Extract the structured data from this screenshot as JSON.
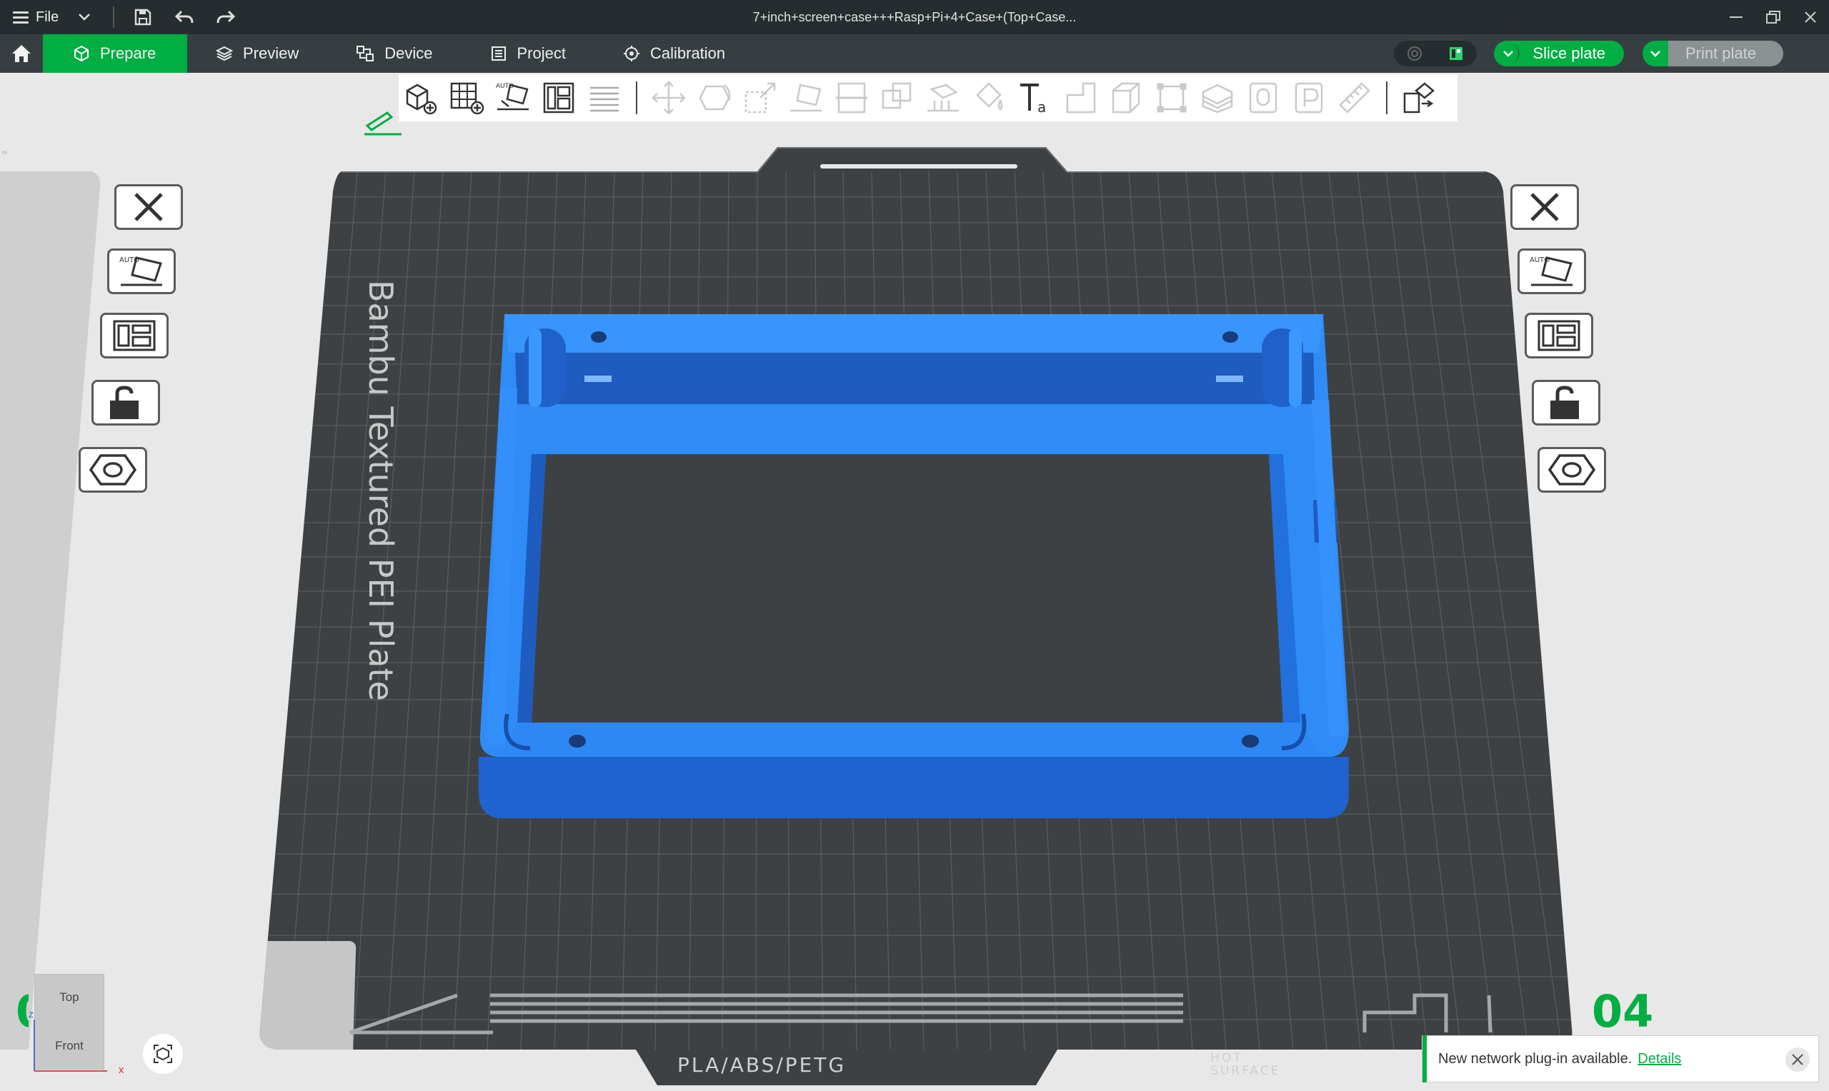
{
  "app": {
    "title": "7+inch+screen+case+++Rasp+Pi+4+Case+(Top+Case...",
    "menu_label": "File"
  },
  "nav": {
    "tabs": [
      {
        "label": "Prepare",
        "active": true,
        "icon": "cube-icon"
      },
      {
        "label": "Preview",
        "icon": "layers-icon"
      },
      {
        "label": "Device",
        "icon": "device-icon"
      },
      {
        "label": "Project",
        "icon": "project-icon"
      },
      {
        "label": "Calibration",
        "icon": "calibration-icon"
      }
    ],
    "slice_label": "Slice plate",
    "print_label": "Print plate"
  },
  "plate": {
    "bed_name": "Bambu Textured PEI Plate",
    "material_text": "PLA/ABS/PETG",
    "hot_surface_line1": "HOT",
    "hot_surface_line2": "SURFACE",
    "plate_number": "04",
    "plate_number_left": "0"
  },
  "view_cube": {
    "top": "Top",
    "front": "Front",
    "axis_x": "x",
    "axis_z": "z"
  },
  "notification": {
    "message": "New network plug-in available.",
    "link": "Details"
  },
  "colors": {
    "brand_green": "#00ae42",
    "model_blue": "#2f8cf7",
    "bed_dark": "#3e4143",
    "titlebar": "#262d31",
    "navbar": "#373e42"
  }
}
